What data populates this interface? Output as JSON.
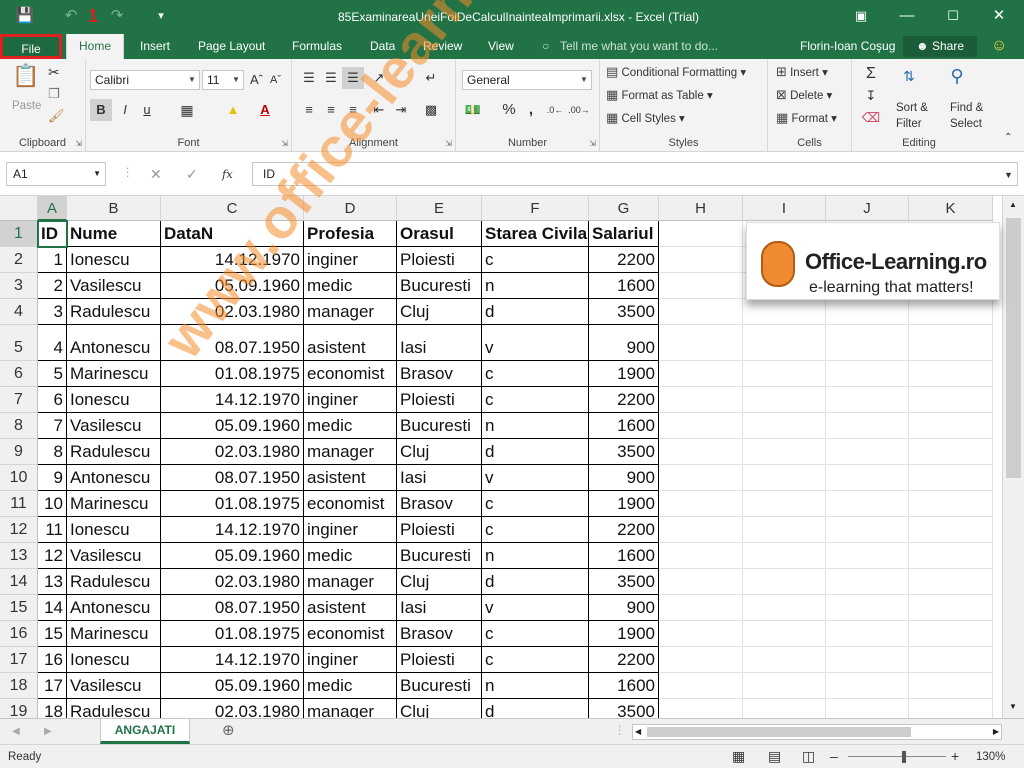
{
  "title_bar": {
    "filename": "85ExaminareaUneiFoiDeCalculInainteaImprimarii.xlsx - Excel (Trial)",
    "user": "Florin-Ioan Coşug",
    "share_label": "Share"
  },
  "annotation": {
    "number": "1"
  },
  "tabs": [
    {
      "label": "Home"
    },
    {
      "label": "Insert"
    },
    {
      "label": "Page Layout"
    },
    {
      "label": "Formulas"
    },
    {
      "label": "Data"
    },
    {
      "label": "Review"
    },
    {
      "label": "View"
    }
  ],
  "file_tab": {
    "label": "File"
  },
  "tell_me": {
    "placeholder": "Tell me what you want to do..."
  },
  "ribbon": {
    "clipboard": {
      "label": "Clipboard",
      "paste": "Paste"
    },
    "font": {
      "label": "Font",
      "name": "Calibri",
      "size": "11",
      "bold": "B",
      "italic": "I",
      "underline": "u"
    },
    "alignment": {
      "label": "Alignment"
    },
    "number": {
      "label": "Number",
      "format": "General",
      "percent": "%",
      "comma": ","
    },
    "styles": {
      "label": "Styles",
      "conditional": "Conditional Formatting",
      "table": "Format as Table",
      "cell": "Cell Styles"
    },
    "cells": {
      "label": "Cells",
      "insert": "Insert",
      "delete": "Delete",
      "format": "Format"
    },
    "editing": {
      "label": "Editing",
      "sort_top": "Sort &",
      "sort_bottom": "Filter",
      "find_top": "Find &",
      "find_bottom": "Select"
    }
  },
  "formula_bar": {
    "name_box": "A1",
    "content": "ID",
    "fx": "fx"
  },
  "columns": [
    "A",
    "B",
    "C",
    "D",
    "E",
    "F",
    "G",
    "H",
    "I",
    "J",
    "K"
  ],
  "headers": [
    "ID",
    "Nume",
    "DataN",
    "Profesia",
    "Orasul",
    "Starea Civila",
    "Salariul"
  ],
  "rows": [
    [
      "1",
      "Ionescu",
      "14.12.1970",
      "inginer",
      "Ploiesti",
      "c",
      "2200"
    ],
    [
      "2",
      "Vasilescu",
      "05.09.1960",
      "medic",
      "Bucuresti",
      "n",
      "1600"
    ],
    [
      "3",
      "Radulescu",
      "02.03.1980",
      "manager",
      "Cluj",
      "d",
      "3500"
    ],
    [
      "4",
      "Antonescu",
      "08.07.1950",
      "asistent",
      "Iasi",
      "v",
      "900"
    ],
    [
      "5",
      "Marinescu",
      "01.08.1975",
      "economist",
      "Brasov",
      "c",
      "1900"
    ],
    [
      "6",
      "Ionescu",
      "14.12.1970",
      "inginer",
      "Ploiesti",
      "c",
      "2200"
    ],
    [
      "7",
      "Vasilescu",
      "05.09.1960",
      "medic",
      "Bucuresti",
      "n",
      "1600"
    ],
    [
      "8",
      "Radulescu",
      "02.03.1980",
      "manager",
      "Cluj",
      "d",
      "3500"
    ],
    [
      "9",
      "Antonescu",
      "08.07.1950",
      "asistent",
      "Iasi",
      "v",
      "900"
    ],
    [
      "10",
      "Marinescu",
      "01.08.1975",
      "economist",
      "Brasov",
      "c",
      "1900"
    ],
    [
      "11",
      "Ionescu",
      "14.12.1970",
      "inginer",
      "Ploiesti",
      "c",
      "2200"
    ],
    [
      "12",
      "Vasilescu",
      "05.09.1960",
      "medic",
      "Bucuresti",
      "n",
      "1600"
    ],
    [
      "13",
      "Radulescu",
      "02.03.1980",
      "manager",
      "Cluj",
      "d",
      "3500"
    ],
    [
      "14",
      "Antonescu",
      "08.07.1950",
      "asistent",
      "Iasi",
      "v",
      "900"
    ],
    [
      "15",
      "Marinescu",
      "01.08.1975",
      "economist",
      "Brasov",
      "c",
      "1900"
    ],
    [
      "16",
      "Ionescu",
      "14.12.1970",
      "inginer",
      "Ploiesti",
      "c",
      "2200"
    ],
    [
      "17",
      "Vasilescu",
      "05.09.1960",
      "medic",
      "Bucuresti",
      "n",
      "1600"
    ],
    [
      "18",
      "Radulescu",
      "02.03.1980",
      "manager",
      "Cluj",
      "d",
      "3500"
    ]
  ],
  "watermark": "www.office-learning.ro",
  "logo": {
    "title": "Office-Learning.ro",
    "tagline": "e-learning that matters!"
  },
  "sheet_tab": "ANGAJATI",
  "status": {
    "ready": "Ready",
    "zoom": "130%"
  },
  "colors": {
    "accent": "#217346",
    "annotation": "#e02020",
    "watermark": "#f58c28"
  }
}
